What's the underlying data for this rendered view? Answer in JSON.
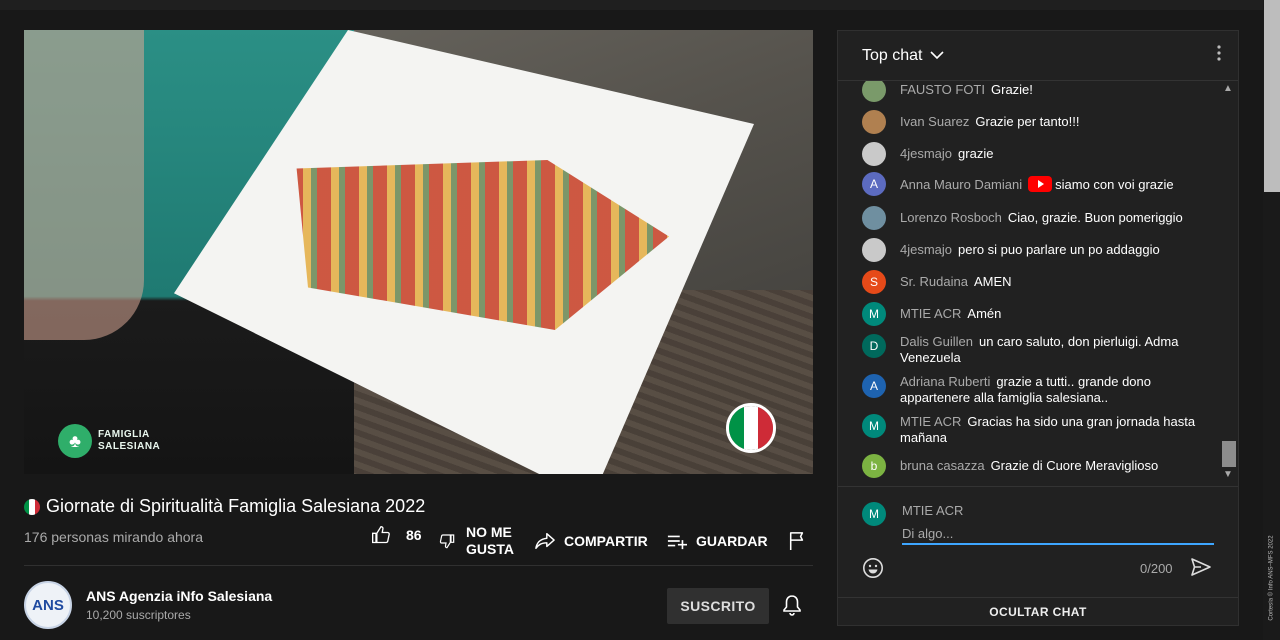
{
  "video": {
    "watermark": {
      "line1": "FAMIGLIA",
      "line2": "SALESIANA"
    },
    "flag_colors": [
      "#009246",
      "#ffffff",
      "#ce2b37"
    ]
  },
  "title": "Giornate di Spiritualità Famiglia Salesiana 2022",
  "viewers": "176 personas mirando ahora",
  "actions": {
    "like_count": "86",
    "dislike_line1": "NO ME",
    "dislike_line2": "GUSTA",
    "share": "COMPARTIR",
    "save": "GUARDAR"
  },
  "channel": {
    "avatar_text": "ANS",
    "name": "ANS Agenzia iNfo Salesiana",
    "subscribers": "10,200 suscriptores",
    "subscribe_label": "SUSCRITO"
  },
  "chat": {
    "header": "Top chat",
    "messages": [
      {
        "author": "FAUSTO FOTI",
        "text": "Grazie!",
        "avatar": "",
        "avatar_color": "#7a9a6a"
      },
      {
        "author": "Ivan Suarez",
        "text": "Grazie per tanto!!!",
        "avatar": "",
        "avatar_color": "#b08050"
      },
      {
        "author": "4jesmajo",
        "text": "grazie",
        "avatar": "",
        "avatar_color": "#c9c9c9"
      },
      {
        "author": "Anna Mauro Damiani",
        "text": "siamo con voi grazie",
        "avatar": "A",
        "avatar_color": "#5c6bc0"
      },
      {
        "author": "Lorenzo Rosboch",
        "text": "Ciao, grazie. Buon pomeriggio",
        "avatar": "",
        "avatar_color": "#6f8fa0"
      },
      {
        "author": "4jesmajo",
        "text": "pero si puo parlare un po addaggio",
        "avatar": "",
        "avatar_color": "#c9c9c9"
      },
      {
        "author": "Sr. Rudaina",
        "text": "AMEN",
        "avatar": "S",
        "avatar_color": "#e64a19"
      },
      {
        "author": "MTIE ACR",
        "text": "Amén",
        "avatar": "M",
        "avatar_color": "#00897b"
      },
      {
        "author": "Dalis Guillen",
        "text": "un caro saluto, don pierluigi. Adma Venezuela",
        "avatar": "D",
        "avatar_color": "#00695c"
      },
      {
        "author": "Adriana Ruberti",
        "text": "grazie a tutti.. grande dono appartenere alla famiglia salesiana..",
        "avatar": "A",
        "avatar_color": "#1e63b0"
      },
      {
        "author": "MTIE ACR",
        "text": "Gracias ha sido una gran jornada hasta mañana",
        "avatar": "M",
        "avatar_color": "#00897b"
      },
      {
        "author": "bruna casazza",
        "text": "Grazie di Cuore Meraviglioso",
        "avatar": "b",
        "avatar_color": "#7cb342"
      }
    ],
    "composer": {
      "user": "MTIE ACR",
      "avatar": "M",
      "placeholder": "Di algo...",
      "counter": "0/200"
    },
    "hide_label": "OCULTAR CHAT"
  },
  "credit": "Cortesía © Info ANS–MFS 2022"
}
